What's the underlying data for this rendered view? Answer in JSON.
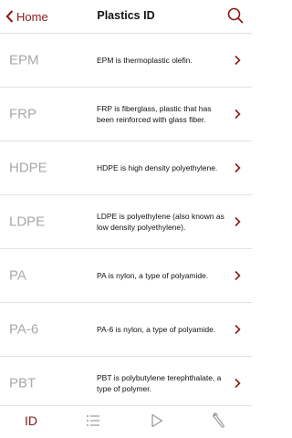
{
  "nav": {
    "back_label": "Home",
    "title": "Plastics ID",
    "back_icon": "chevron-left-icon",
    "search_icon": "search-icon"
  },
  "colors": {
    "accent": "#8b1a1a",
    "code_gray": "#a8a8a8",
    "divider": "#e3e3e3"
  },
  "rows": [
    {
      "code": "EPM",
      "description": "EPM is thermoplastic olefin."
    },
    {
      "code": "FRP",
      "description": "FRP is fiberglass, plastic that has been reinforced with glass fiber."
    },
    {
      "code": "HDPE",
      "description": "HDPE is high density polyethylene."
    },
    {
      "code": "LDPE",
      "description": "LDPE is polyethylene (also known as low density polyethylene)."
    },
    {
      "code": "PA",
      "description": "PA is nylon, a type of polyamide."
    },
    {
      "code": "PA-6",
      "description": "PA-6 is nylon, a type of polyamide."
    },
    {
      "code": "PBT",
      "description": "PBT is polybutylene terephthalate, a type of polymer."
    }
  ],
  "tabbar": {
    "id_label": "ID",
    "tabs": [
      "id-tab",
      "list-tab",
      "play-tab",
      "tools-tab"
    ]
  }
}
